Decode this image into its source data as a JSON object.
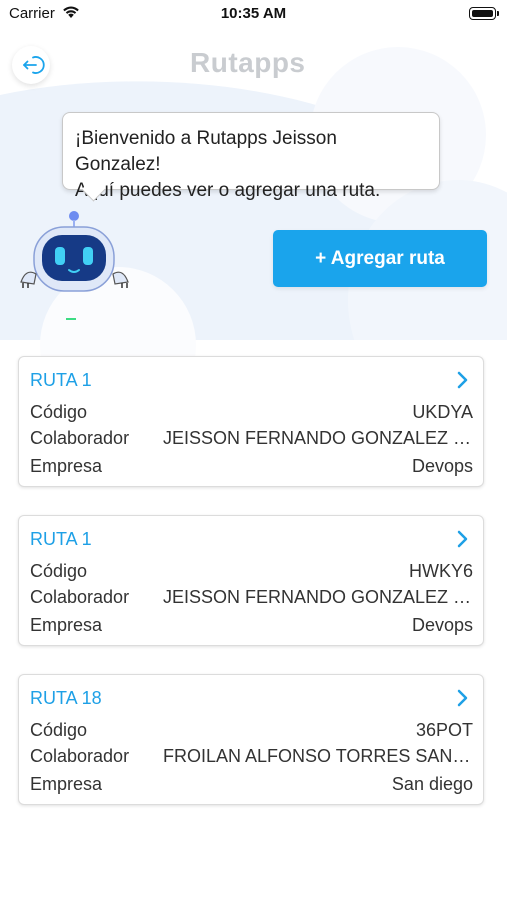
{
  "status_bar": {
    "carrier": "Carrier",
    "time": "10:35 AM"
  },
  "header": {
    "brand": "Rutapps",
    "logout_icon": "logout-icon"
  },
  "welcome": {
    "line1": "¡Bienvenido a Rutapps Jeisson Gonzalez!",
    "line2": "Aquí puedes ver o agregar una ruta."
  },
  "actions": {
    "add_route_label": "+ Agregar ruta"
  },
  "labels": {
    "code": "Código",
    "collaborator": "Colaborador",
    "company": "Empresa"
  },
  "routes": [
    {
      "title": "RUTA 1",
      "code": "UKDYA",
      "collaborator": "JEISSON FERNANDO GONZALEZ PALACIOS",
      "company": "Devops"
    },
    {
      "title": "RUTA 1",
      "code": "HWKY6",
      "collaborator": "JEISSON FERNANDO GONZALEZ PALACIOS",
      "company": "Devops"
    },
    {
      "title": "RUTA 18",
      "code": "36POT",
      "collaborator": "FROILAN ALFONSO TORRES SANCHEZ",
      "company": "San diego"
    }
  ],
  "colors": {
    "accent": "#1aa4ec",
    "card_title": "#1ea0e6",
    "brand_grey": "#c9ccd0"
  }
}
